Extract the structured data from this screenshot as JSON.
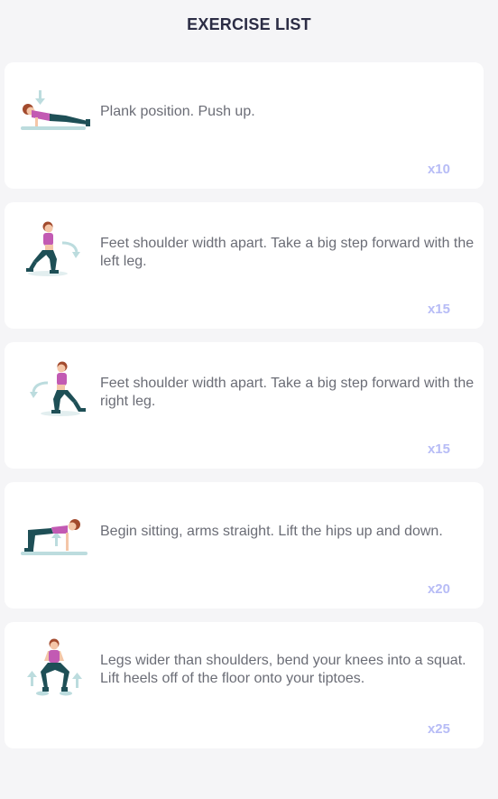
{
  "header": {
    "title": "EXERCISE LIST"
  },
  "exercises": [
    {
      "icon": "push-up-figure-icon",
      "description": "Plank position. Push up.",
      "reps": "x10"
    },
    {
      "icon": "lunge-left-figure-icon",
      "description": "Feet shoulder width apart. Take a big step forward with the left leg.",
      "reps": "x15"
    },
    {
      "icon": "lunge-right-figure-icon",
      "description": "Feet shoulder width apart. Take a big step forward with the right leg.",
      "reps": "x15"
    },
    {
      "icon": "hip-lift-figure-icon",
      "description": "Begin sitting, arms straight. Lift the hips up and down.",
      "reps": "x20"
    },
    {
      "icon": "squat-tiptoe-figure-icon",
      "description": "Legs wider than shoulders, bend your knees into a squat. Lift heels off of the floor onto your tiptoes.",
      "reps": "x25"
    }
  ],
  "colors": {
    "background": "#f5f5f7",
    "card": "#ffffff",
    "title": "#2c2d45",
    "text": "#6b6d76",
    "reps": "#b7bcf6",
    "top": "#c25ab3",
    "pants": "#1e4f56",
    "hair": "#a24a2d",
    "skin": "#f4c6a8",
    "mat": "#bcdcde",
    "arrow": "#bcdcde"
  }
}
